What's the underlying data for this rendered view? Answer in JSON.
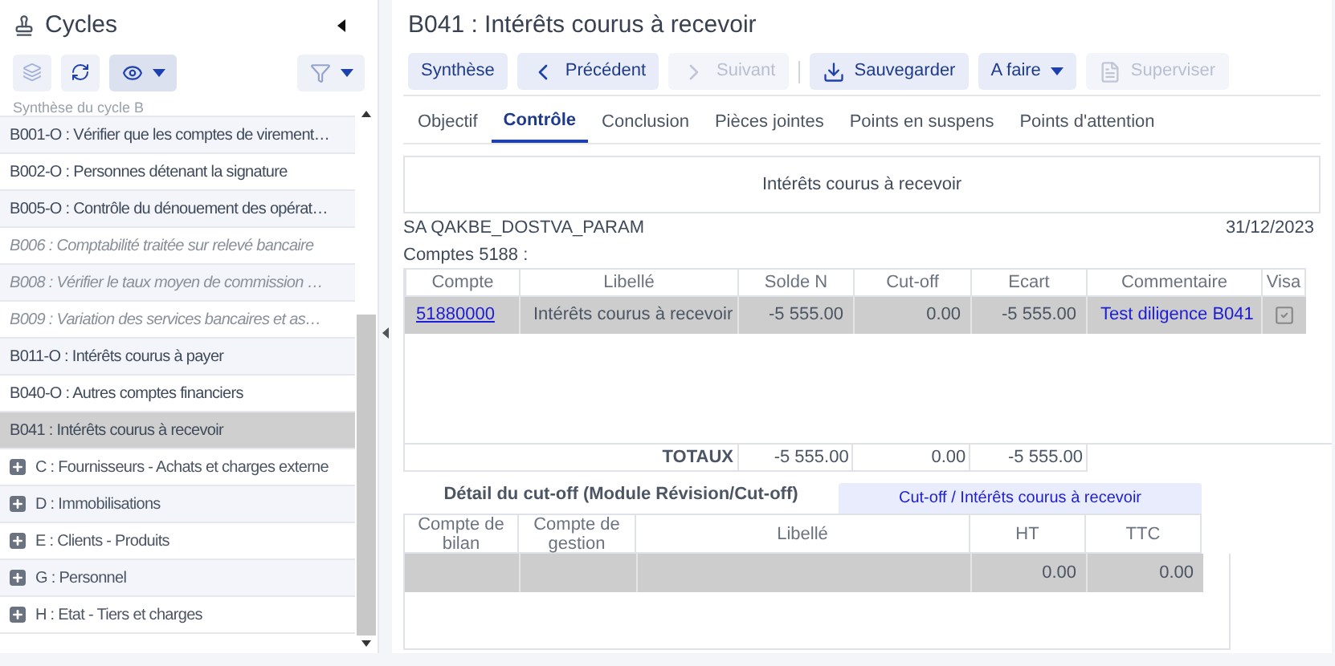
{
  "sidebar": {
    "title": "Cycles",
    "items": [
      {
        "label": "Synthèse du cycle B",
        "kind": "partial",
        "selected": false
      },
      {
        "label": "B001-O : Vérifier que les comptes de virement…",
        "kind": "bold",
        "selected": false
      },
      {
        "label": "B002-O : Personnes détenant la signature",
        "kind": "bold",
        "selected": false
      },
      {
        "label": "B005-O : Contrôle du dénouement des opérat…",
        "kind": "bold",
        "selected": false
      },
      {
        "label": "B006 : Comptabilité traitée sur relevé bancaire",
        "kind": "italic",
        "selected": false
      },
      {
        "label": "B008 : Vérifier le taux moyen de commission …",
        "kind": "italic",
        "selected": false
      },
      {
        "label": "B009 : Variation des services bancaires et as…",
        "kind": "italic",
        "selected": false
      },
      {
        "label": "B011-O : Intérêts courus à payer",
        "kind": "bold",
        "selected": false
      },
      {
        "label": "B040-O : Autres comptes financiers",
        "kind": "bold",
        "selected": false
      },
      {
        "label": "B041 : Intérêts courus à recevoir",
        "kind": "bold",
        "selected": true
      },
      {
        "label": "C : Fournisseurs - Achats et charges externe",
        "kind": "group",
        "selected": false
      },
      {
        "label": "D : Immobilisations",
        "kind": "group",
        "selected": false
      },
      {
        "label": "E : Clients - Produits",
        "kind": "group",
        "selected": false
      },
      {
        "label": "G : Personnel",
        "kind": "group",
        "selected": false
      },
      {
        "label": "H : Etat - Tiers et charges",
        "kind": "group",
        "selected": false
      }
    ]
  },
  "page": {
    "title": "B041 : Intérêts courus à recevoir"
  },
  "toolbar": [
    {
      "label": "Synthèse",
      "kind": "plain",
      "disabled": false
    },
    {
      "label": "Précédent",
      "kind": "prev",
      "disabled": false
    },
    {
      "label": "Suivant",
      "kind": "next",
      "disabled": true
    },
    {
      "label": "Sauvegarder",
      "kind": "save",
      "disabled": false
    },
    {
      "label": "A faire",
      "kind": "menu",
      "disabled": false
    },
    {
      "label": "Superviser",
      "kind": "doc",
      "disabled": true
    }
  ],
  "tabs": [
    {
      "label": "Objectif",
      "selected": false
    },
    {
      "label": "Contrôle",
      "selected": true
    },
    {
      "label": "Conclusion",
      "selected": false
    },
    {
      "label": "Pièces jointes",
      "selected": false
    },
    {
      "label": "Points en suspens",
      "selected": false
    },
    {
      "label": "Points d'attention",
      "selected": false
    }
  ],
  "section_title": "Intérêts courus à recevoir",
  "company": "SA QAKBE_DOSTVA_PARAM",
  "date": "31/12/2023",
  "accounts_label": "Comptes 5188 :",
  "table": {
    "columns": [
      "Compte",
      "Libellé",
      "Solde N",
      "Cut-off",
      "Ecart",
      "Commentaire",
      "Visa"
    ],
    "rows": [
      {
        "compte": "51880000",
        "libelle": "Intérêts courus à recevoir",
        "solde": "-5 555.00",
        "cutoff": "0.00",
        "ecart": "-5 555.00",
        "commentaire": "Test diligence B041",
        "visa": true
      }
    ],
    "totals": {
      "label": "TOTAUX",
      "solde": "-5 555.00",
      "cutoff": "0.00",
      "ecart": "-5 555.00"
    }
  },
  "detail": {
    "title": "Détail du cut-off (Module Révision/Cut-off)",
    "tab": "Cut-off / Intérêts courus à recevoir",
    "columns": [
      "Compte de bilan",
      "Compte de gestion",
      "Libellé",
      "HT",
      "TTC"
    ],
    "rows": [
      {
        "ht": "0.00",
        "ttc": "0.00"
      }
    ]
  }
}
